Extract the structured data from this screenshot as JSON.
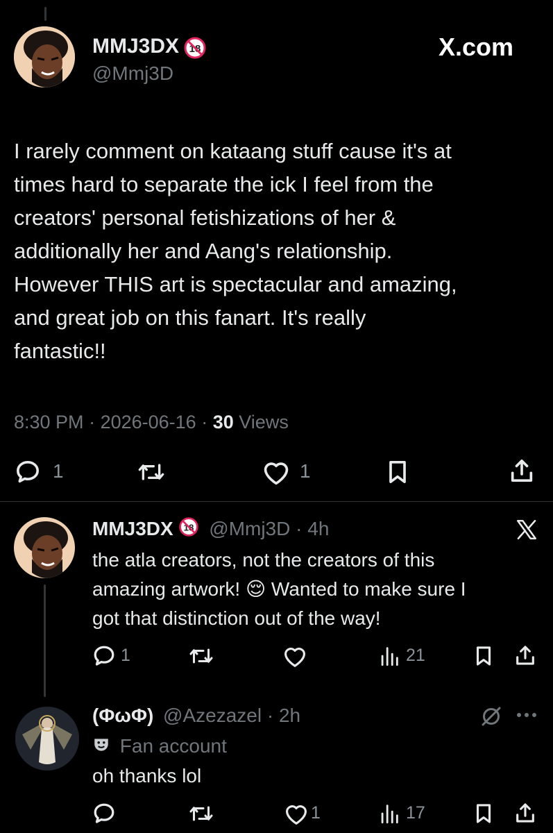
{
  "main_tweet": {
    "display_name": "MMJ3DX",
    "handle": "@Mmj3D",
    "brand": "X.com",
    "text_lines": [
      "I rarely comment on kataang stuff cause it's at",
      "times hard to separate the ick I feel from the",
      "creators' personal fetishizations of her &",
      "additionally her and Aang's relationship.",
      "However THIS art is spectacular and amazing,",
      "and great job on this fanart. It's really",
      "fantastic!!"
    ],
    "time": "8:30 PM",
    "date": "2026-06-16",
    "views_count": "30",
    "views_label": "Views",
    "replies": "1",
    "likes": "1"
  },
  "reply1": {
    "display_name": "MMJ3DX",
    "handle": "@Mmj3D",
    "age": "4h",
    "text_lines": [
      "the atla creators, not the creators of this",
      "amazing artwork! 😌 Wanted to make sure I",
      "got that distinction out of the way!"
    ],
    "replies": "1",
    "views": "21"
  },
  "reply2": {
    "display_name": "(ΦωΦ)",
    "handle": "@Azezazel",
    "age": "2h",
    "label": "Fan account",
    "text": "oh thanks lol",
    "likes": "1",
    "views": "17"
  }
}
